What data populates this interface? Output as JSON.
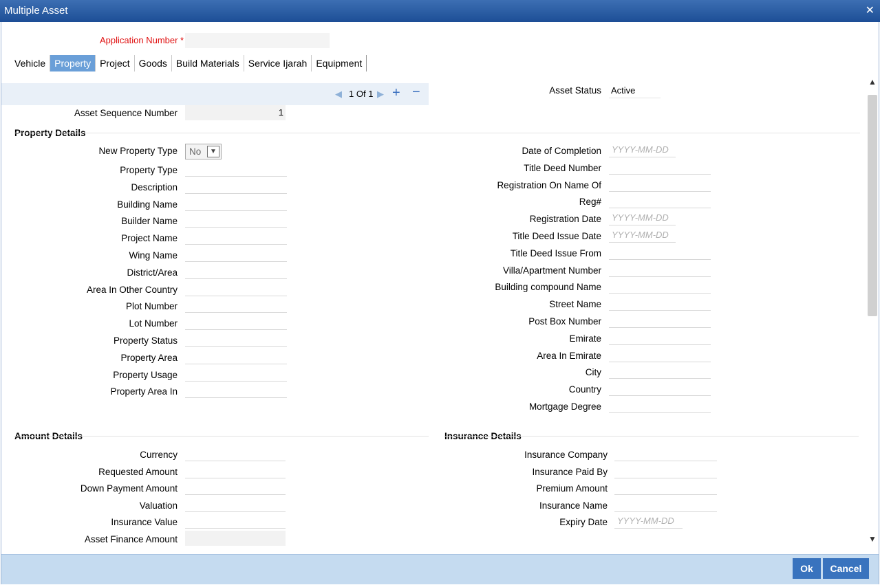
{
  "window": {
    "title": "Multiple Asset",
    "close_glyph": "✕"
  },
  "application_number": {
    "label": "Application Number *",
    "value": ""
  },
  "tabs": [
    "Vehicle",
    "Property",
    "Project",
    "Goods",
    "Build Materials",
    "Service Ijarah",
    "Equipment"
  ],
  "active_tab": "Property",
  "navigator": {
    "current": "1",
    "of_label": "Of",
    "total": "1"
  },
  "asset_status": {
    "label": "Asset Status",
    "value": "Active"
  },
  "asset_sequence": {
    "label": "Asset Sequence Number",
    "value": "1"
  },
  "property_details": {
    "title": "Property Details",
    "new_property_type": {
      "label": "New Property Type",
      "value": "No"
    },
    "left_fields": [
      "Property Type",
      "Description",
      "Building Name",
      "Builder Name",
      "Project Name",
      "Wing Name",
      "District/Area",
      "Area In Other Country",
      "Plot Number",
      "Lot Number",
      "Property Status",
      "Property Area",
      "Property Usage",
      "Property Area In"
    ],
    "right_fields": [
      "Date of Completion",
      "Title Deed Number",
      "Registration On Name Of",
      "Reg#",
      "Registration Date",
      "Title Deed Issue Date",
      "Title Deed Issue From",
      "Villa/Apartment Number",
      "Building compound Name",
      "Street Name",
      "Post Box Number",
      "Emirate",
      "Area In Emirate",
      "City",
      "Country",
      "Mortgage Degree"
    ]
  },
  "amount_details": {
    "title": "Amount Details",
    "fields": [
      "Currency",
      "Requested Amount",
      "Down Payment Amount",
      "Valuation",
      "Insurance Value",
      "Asset Finance Amount"
    ]
  },
  "insurance_details": {
    "title": "Insurance Details",
    "fields": [
      "Insurance Company",
      "Insurance Paid By",
      "Premium Amount",
      "Insurance Name",
      "Expiry Date"
    ]
  },
  "date_placeholder": "YYYY-MM-DD",
  "buttons": {
    "ok": "Ok",
    "cancel": "Cancel"
  },
  "colors": {
    "titlebar": "#2a5ea8",
    "accent": "#3973be",
    "required": "#e01010",
    "footer": "#c5dbf0"
  }
}
